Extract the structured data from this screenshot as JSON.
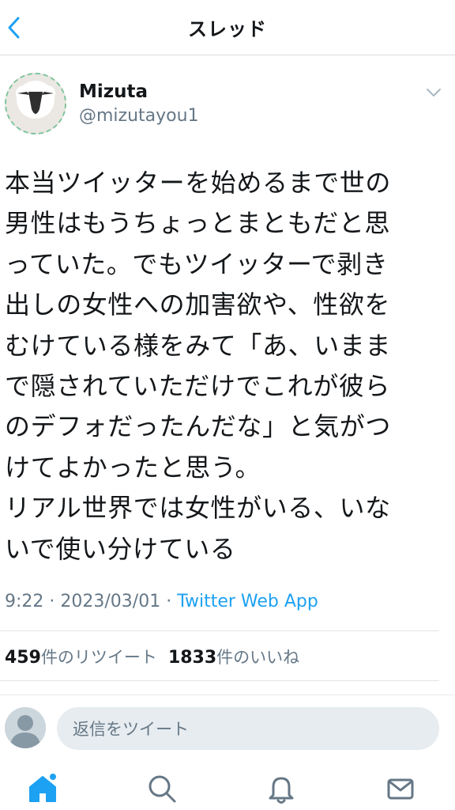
{
  "header": {
    "title": "スレッド"
  },
  "author": {
    "name": "Mizuta",
    "handle": "@mizutayou1"
  },
  "tweet": {
    "lines": [
      "本当ツイッターを始めるまで世の",
      "男性はもうちょっとまともだと思",
      "っていた。でもツイッターで剥き",
      "出しの女性への加害欲や、性欲を",
      "むけている様をみて「あ、いまま",
      "で隠されていただけでこれが彼ら",
      "のデフォだったんだな」と気がつ",
      "けてよかったと思う。",
      "リアル世界では女性がいる、いな",
      "いで使い分けている"
    ],
    "time": "9:22",
    "date": "2023/03/01",
    "source": "Twitter Web App"
  },
  "stats": {
    "retweets_count": "459",
    "retweets_label": "件のリツイート",
    "likes_count": "1833",
    "likes_label": "件のいいね"
  },
  "reply": {
    "placeholder": "返信をツイート"
  },
  "colors": {
    "accent": "#1da1f2",
    "secondary_text": "#657786",
    "primary_text": "#14171a"
  },
  "tabs": [
    {
      "icon": "home-icon",
      "has_badge": true
    },
    {
      "icon": "search-icon"
    },
    {
      "icon": "bell-icon"
    },
    {
      "icon": "envelope-icon"
    }
  ]
}
